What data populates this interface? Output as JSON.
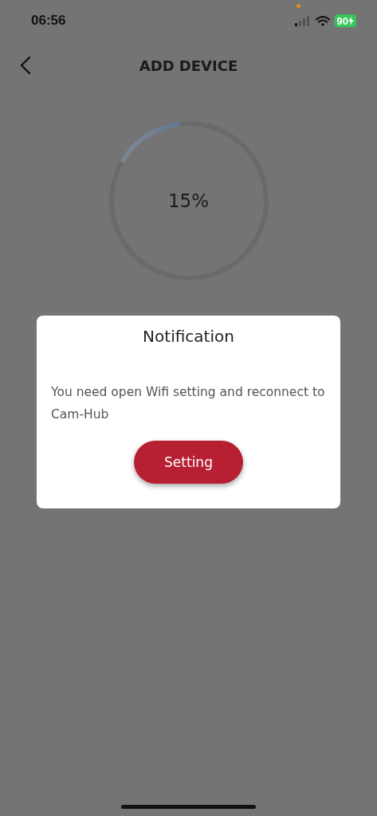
{
  "status_bar": {
    "time": "06:56",
    "battery": "90"
  },
  "header": {
    "title": "ADD DEVICE"
  },
  "progress": {
    "level": 0.15,
    "reading": "15%"
  },
  "dialog": {
    "title": "Notification",
    "message": "You need open Wifi setting and reconnect to Cam-Hub",
    "button": "Setting"
  }
}
